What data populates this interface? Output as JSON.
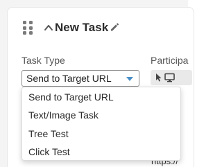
{
  "task": {
    "title": "New Task",
    "icons": {
      "drag": "drag-handle-icon",
      "collapse": "chevron-up-icon",
      "edit": "pencil-icon"
    }
  },
  "task_type": {
    "label": "Task Type",
    "selected": "Send to Target URL",
    "options": [
      "Send to Target URL",
      "Text/Image Task",
      "Tree Test",
      "Click Test"
    ]
  },
  "participants": {
    "label": "Participa",
    "icons": [
      "cursor-icon",
      "monitor-icon"
    ]
  },
  "behind_dropdown_text": "https://",
  "colors": {
    "caret": "#4a90c8",
    "text": "#2a2a2a",
    "border": "#8a8a8a"
  }
}
